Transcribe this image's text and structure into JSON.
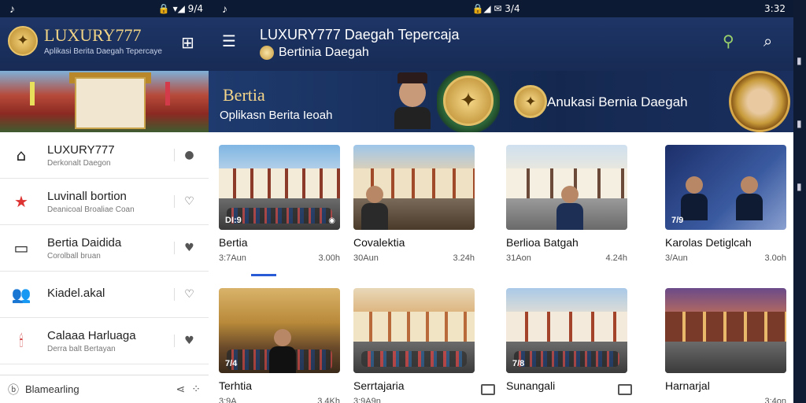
{
  "status_left": {
    "left_icon": "tiktok-icon",
    "icons": "🔒 ▾◢ 9/4"
  },
  "status_right": {
    "left_icon": "tiktok-icon",
    "icons": "🔒◢ ✉ 3/4",
    "time": "3:32"
  },
  "header": {
    "brand_name": "LUXURY777",
    "brand_sub": "Aplikasi Berita Daegah Tepercaye",
    "title": "LUXURY777 Daegah Tepercaja",
    "subtitle": "Bertinia Daegah"
  },
  "sidebar": {
    "items": [
      {
        "title": "LUXURY777",
        "sub": "Derkonalt Daegon",
        "icon": "building-icon",
        "glyph": "⌂",
        "action": "●"
      },
      {
        "title": "Luvinall bortion",
        "sub": "Deanicoal Broaliae Coan",
        "icon": "star-icon",
        "glyph": "★",
        "action": "♡"
      },
      {
        "title": "Bertia Daidida",
        "sub": "Corolball bruan",
        "icon": "square-icon",
        "glyph": "▭",
        "action": "♥"
      },
      {
        "title": "Kiadel.akal",
        "sub": "",
        "icon": "people-icon",
        "glyph": "👥",
        "action": "♡"
      },
      {
        "title": "Calaaa Harluaga",
        "sub": "Derra balt Bertayan",
        "icon": "candles-icon",
        "glyph": "🕯",
        "action": "♥"
      }
    ],
    "footer": "Blamearling"
  },
  "banner": {
    "title": "Bertia",
    "sub": "Oplikasn Berita Ieoah",
    "mid": "Anukasi Bernia Daegah"
  },
  "cards": [
    {
      "title": "Bertia",
      "time": "3:7Aun",
      "meta": "3.00h",
      "badge": "DI:9"
    },
    {
      "title": "Covalektia",
      "time": "30Aun",
      "meta": "3.24h",
      "badge": ""
    },
    {
      "title": "Berlioa Batgah",
      "time": "31Aon",
      "meta": "4.24h",
      "badge": ""
    },
    {
      "title": "Karolas Detiglcah",
      "time": "3/Aun",
      "meta": "3.0oh",
      "badge": "7/9"
    },
    {
      "title": "Terhtia",
      "time": "3:9A",
      "meta": "3.4Kh",
      "badge": "7/4"
    },
    {
      "title": "Serrtajaria",
      "time": "3:9A9n",
      "meta": "",
      "badge": ""
    },
    {
      "title": "Sunangali",
      "time": "",
      "meta": "",
      "badge": "7/8"
    },
    {
      "title": "Harnarjal",
      "time": "",
      "meta": "3:4on",
      "badge": ""
    }
  ],
  "colors": {
    "header": "#1e3566",
    "gold": "#f1d486",
    "accent": "#2a5bd7"
  }
}
